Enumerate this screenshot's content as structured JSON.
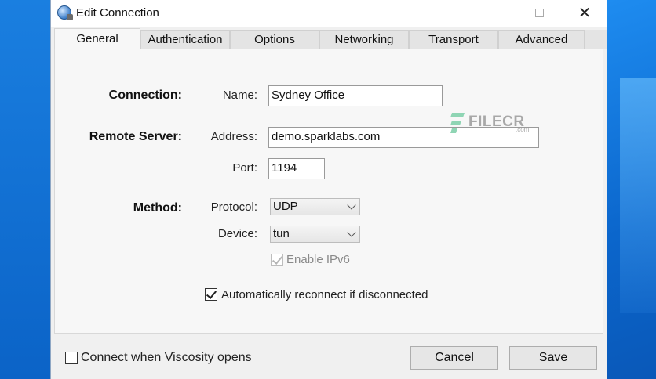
{
  "window": {
    "title": "Edit Connection"
  },
  "tabs": [
    {
      "label": "General"
    },
    {
      "label": "Authentication"
    },
    {
      "label": "Options"
    },
    {
      "label": "Networking"
    },
    {
      "label": "Transport"
    },
    {
      "label": "Advanced"
    }
  ],
  "general": {
    "connection_section": "Connection:",
    "name_label": "Name:",
    "name_value": "Sydney Office",
    "remote_section": "Remote Server:",
    "address_label": "Address:",
    "address_value": "demo.sparklabs.com",
    "port_label": "Port:",
    "port_value": "1194",
    "method_section": "Method:",
    "protocol_label": "Protocol:",
    "protocol_value": "UDP",
    "device_label": "Device:",
    "device_value": "tun",
    "ipv6_label": "Enable IPv6",
    "ipv6_checked": true,
    "auto_reconnect_label": "Automatically reconnect if disconnected",
    "auto_reconnect_checked": true
  },
  "footer": {
    "connect_on_open_label": "Connect when Viscosity opens",
    "connect_on_open_checked": false,
    "cancel_label": "Cancel",
    "save_label": "Save"
  },
  "watermark": {
    "brand": "FILECR",
    "suffix": ".com"
  },
  "icons": [
    "app-globe-icon",
    "minimize-icon",
    "maximize-icon",
    "close-icon",
    "chevron-down-icon",
    "checkmark-icon"
  ],
  "colors": {
    "desktop_blue": "#0b63c7",
    "window_bg": "#f0f0f0",
    "panel_bg": "#f7f7f7",
    "watermark_green": "#8fd5b4"
  }
}
